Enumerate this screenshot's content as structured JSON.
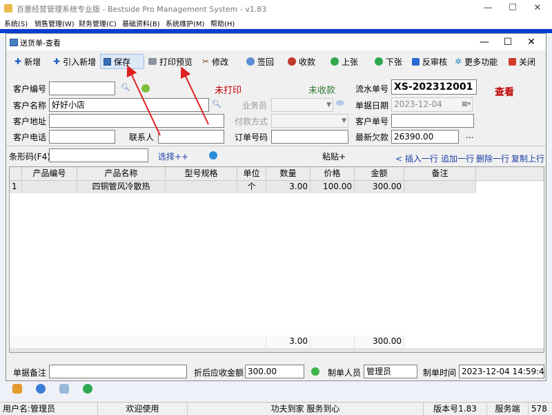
{
  "app": {
    "title": "百惠经营管理系统专业版 - Bestside Pro Management System - v1.83",
    "window_controls": {
      "minimize": "—",
      "maximize": "☐",
      "close": "✕"
    }
  },
  "menu": [
    "系统(S)",
    "销售管理(W)",
    "财务管理(C)",
    "基础资料(B)",
    "系统维护(M)",
    "帮助(H)"
  ],
  "dialog": {
    "title": "送货单-查看",
    "controls": {
      "minimize": "—",
      "maximize": "☐",
      "close": "✕"
    }
  },
  "toolbar": {
    "add": "新增",
    "import_add": "引入新增",
    "save": "保存",
    "print_preview": "打印预览",
    "edit": "修改",
    "sign_back": "签回",
    "receive": "收款",
    "prev": "上张",
    "next": "下张",
    "unaudit": "反审核",
    "more": "更多功能",
    "close": "关闭"
  },
  "form": {
    "customer_code_label": "客户编号",
    "customer_code_value": "",
    "customer_name_label": "客户名称",
    "customer_name_value": "好好小店",
    "customer_address_label": "客户地址",
    "customer_address_value": "",
    "customer_phone_label": "客户电话",
    "customer_phone_value": "",
    "contact_label": "联系人",
    "contact_value": "",
    "print_status": "未打印",
    "payment_status": "未收款",
    "salesperson_label": "业务员",
    "payment_method_label": "付款方式",
    "order_no_label": "订单号码",
    "order_no_value": "",
    "serial_no_label": "流水单号",
    "serial_no_value": "XS-202312001",
    "doc_date_label": "单据日期",
    "doc_date_value": "2023-12-04",
    "customer_doc_label": "客户单号",
    "customer_doc_value": "",
    "latest_debt_label": "最新欠款",
    "latest_debt_value": "26390.00",
    "mode_label": "查看",
    "ellipsis": "..."
  },
  "barcode_row": {
    "label": "条形码(F4)",
    "value": "",
    "select_more": "选择++",
    "paste_more": "粘贴+",
    "insert_row": "< 插入一行",
    "append_row": "追加一行",
    "delete_row": "删除一行",
    "copy_prev": "复制上行"
  },
  "grid": {
    "columns": [
      "产品编号",
      "产品名称",
      "型号规格",
      "单位",
      "数量",
      "价格",
      "金额",
      "备注"
    ],
    "rows": [
      {
        "no": "1",
        "code": "",
        "name": "四铜管风冷散热",
        "spec": "",
        "unit": "个",
        "qty": "3.00",
        "price": "100.00",
        "amount": "300.00",
        "remark": ""
      }
    ],
    "totals": {
      "qty": "3.00",
      "amount": "300.00"
    }
  },
  "bottom": {
    "remark_label": "单据备注",
    "remark_value": "",
    "discount_label": "折后应收金额",
    "discount_value": "300.00",
    "maker_label": "制单人员",
    "maker_value": "管理员",
    "make_time_label": "制单时间",
    "make_time_value": "2023-12-04 14:59:41"
  },
  "statusbar": {
    "user": "用户名:管理员",
    "welcome": "欢迎使用",
    "slogan": "功夫到家 服务到心",
    "version": "版本号1.83",
    "server": "服务端",
    "count": "578"
  },
  "colors": {
    "accent_blue": "#0a3fd0",
    "status_red": "#c00000",
    "status_green": "#2e7d32",
    "link_blue": "#1a3fa8"
  }
}
